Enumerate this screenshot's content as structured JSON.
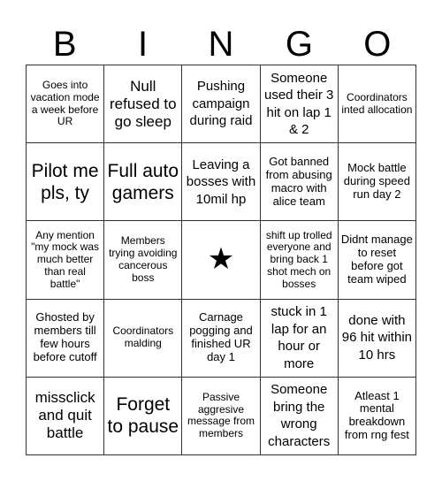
{
  "title_letters": [
    "B",
    "I",
    "N",
    "G",
    "O"
  ],
  "free_space_icon": "star-icon",
  "free_space_glyph": "★",
  "cells": [
    [
      "Goes into vacation mode a week before UR",
      "Null refused to go sleep",
      "Pushing campaign during raid",
      "Someone used their 3 hit on lap 1 & 2",
      "Coordinators inted allocation"
    ],
    [
      "Pilot me pls, ty",
      "Full auto gamers",
      "Leaving a bosses with 10mil hp",
      "Got banned from abusing macro with alice team",
      "Mock battle during speed run day 2"
    ],
    [
      "Any mention \"my mock was much better than real battle\"",
      "Members trying avoiding cancerous boss",
      "★",
      "shift up trolled everyone and bring back 1 shot mech on bosses",
      "Didnt manage to reset before got team wiped"
    ],
    [
      "Ghosted by members till few hours before cutoff",
      "Coordinators malding",
      "Carnage pogging and finished UR day 1",
      "stuck in 1 lap for an hour or more",
      "done with 96 hit within 10 hrs"
    ],
    [
      "missclick and quit battle",
      "Forget to pause",
      "Passive aggresive message from members",
      "Someone bring the wrong characters",
      "Atleast 1 mental breakdown from rng fest"
    ]
  ]
}
